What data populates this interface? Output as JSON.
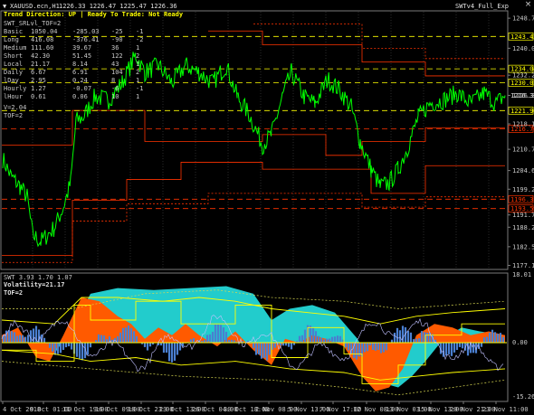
{
  "window": {
    "title": "XAUUSD.ecn,H1",
    "ohlc": "1226.33 1226.47 1225.47 1226.36",
    "status": "Trend Direction:  UP  |  Ready To Trade:  Not Ready",
    "expert": "SWTv4_Full_Exp"
  },
  "indicator_label": "SWT_SRLvl_TOF=2",
  "stats_table": [
    [
      "Basic",
      "1050.04",
      "-285.03",
      "-25",
      "-1"
    ],
    [
      "Long",
      "416.08",
      "-376.41",
      "-90",
      "-2"
    ],
    [
      "Medium",
      "111.60",
      "39.67",
      "36",
      "1"
    ],
    [
      "Short",
      "42.30",
      "51.45",
      "122",
      "2"
    ],
    [
      "Local",
      "21.17",
      "8.14",
      "43",
      "1"
    ],
    [
      "Daily",
      "6.67",
      "6.91",
      "104",
      "2"
    ],
    [
      "lDay",
      "2.95",
      "0.24",
      "8",
      "1"
    ],
    [
      "Hourly",
      "1.27",
      "-0.07",
      "-6",
      "-1"
    ],
    [
      "lHour",
      "0.61",
      "0.06",
      "10",
      "1"
    ]
  ],
  "v_value": "V=2.04",
  "tof_value": "TOF=2",
  "price_axis": [
    "1248.70",
    "1240.00",
    "1232.20",
    "1226.36",
    "1218.10",
    "1210.75",
    "1204.60",
    "1199.20",
    "1191.75",
    "1188.20",
    "1182.55",
    "1177.15"
  ],
  "price_levels": [
    {
      "value": "1243.42",
      "color": "#ffff00"
    },
    {
      "value": "1234.04",
      "color": "#ffff00"
    },
    {
      "value": "1230.05",
      "color": "#ffff00"
    },
    {
      "value": "1221.96",
      "color": "#ffff00"
    },
    {
      "value": "1216.70",
      "color": "#ff3300"
    },
    {
      "value": "1196.31",
      "color": "#ff3300"
    },
    {
      "value": "1193.59",
      "color": "#ff3300"
    }
  ],
  "current_price": "1226.36",
  "sub_panel": {
    "label": "SWT 3.93 1.70 1.07",
    "volatility": "Volatility=21.17",
    "tof": "TOF=2",
    "axis_top": "18.01",
    "axis_zero": "0.00",
    "axis_bottom": "-15.26"
  },
  "time_axis": [
    "4 Oct 2018",
    "9 Oct 01:00",
    "11 Oct 19:00",
    "16 Oct 09:00",
    "18 Oct 23:00",
    "23 Oct 13:00",
    "26 Oct 04:00",
    "30 Oct 18:00",
    "2 Nov 08:00",
    "5 Nov 13:00",
    "7 Nov 17:00",
    "12 Nov 08:00",
    "13 Nov 03:00",
    "15 Nov 13:00",
    "20 Nov 21:00",
    "23 Nov 11:00"
  ],
  "colors": {
    "price_line": "#00ff00",
    "support": "#ff3300",
    "resistance": "#ffff00",
    "cyan_fill": "#22cccc",
    "orange_fill": "#ff5a00",
    "blue_hist": "#4a7fd0"
  },
  "controls": {
    "close_glyph": "×"
  }
}
